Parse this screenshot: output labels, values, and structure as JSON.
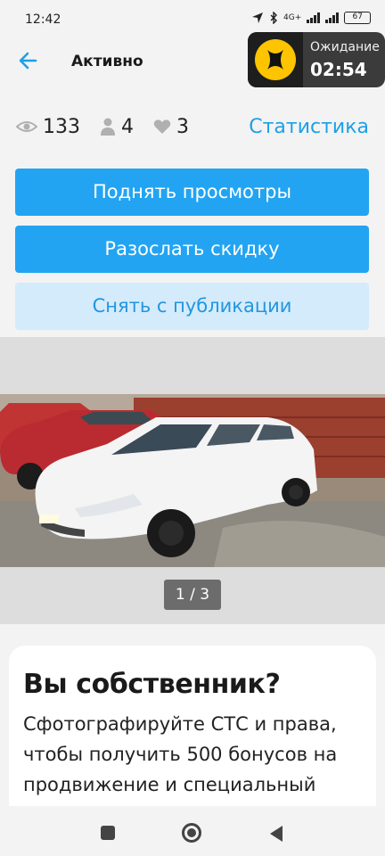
{
  "status_bar": {
    "time": "12:42",
    "network": "4G+",
    "battery": "67"
  },
  "app_bar": {
    "title": "Активно"
  },
  "timer": {
    "label": "Ожидание",
    "value": "02:54"
  },
  "stats": {
    "views": "133",
    "users": "4",
    "likes": "3",
    "link": "Статистика"
  },
  "actions": {
    "boost": "Поднять просмотры",
    "discount": "Разослать скидку",
    "unpublish": "Снять с публикации"
  },
  "gallery": {
    "counter": "1 / 3"
  },
  "owner_card": {
    "title": "Вы собственник?",
    "text": "Сфотографируйте СТС и права, чтобы получить 500 бонусов на продвижение и специальный"
  },
  "colors": {
    "accent": "#22a4f2",
    "accent_light": "#d4ebfb",
    "link": "#1ca0e8"
  }
}
